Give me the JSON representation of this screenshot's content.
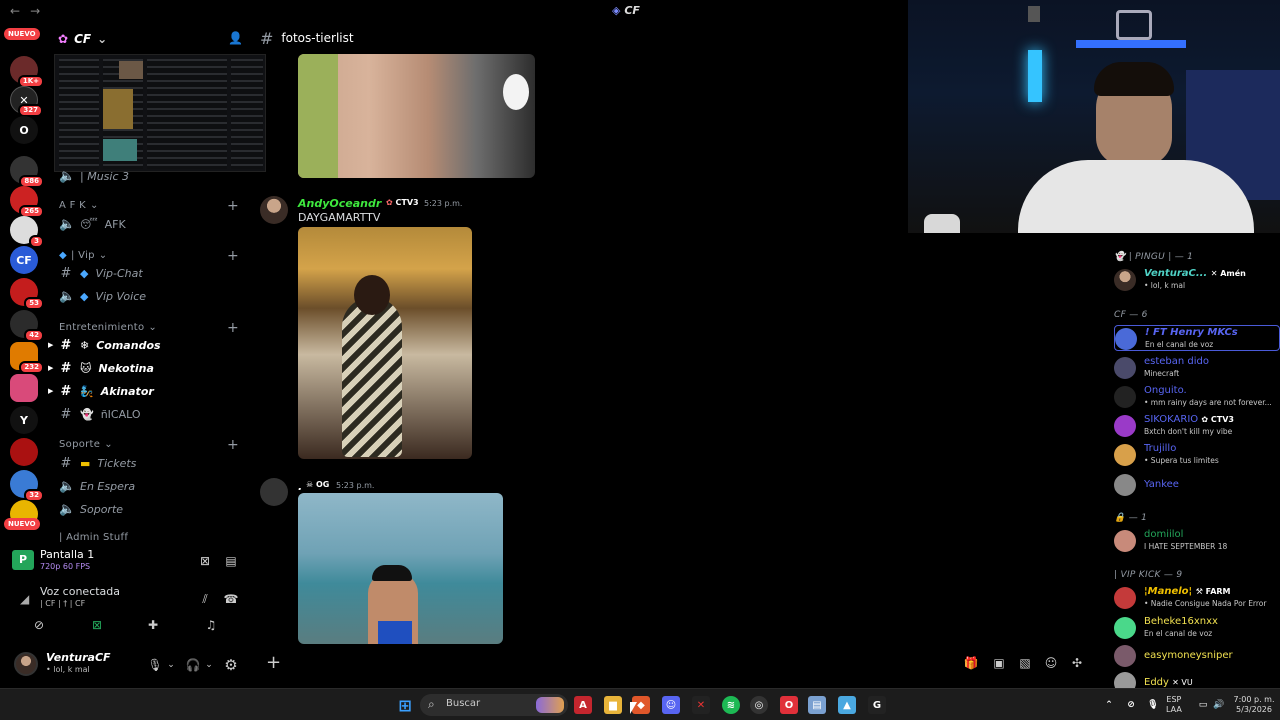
{
  "window": {
    "title": "CF",
    "back": "←",
    "forward": "→"
  },
  "rail": {
    "nuevo_top": "NUEVO",
    "nuevo_bottom": "NUEVO",
    "badges": [
      "1K+",
      "327",
      "886",
      "265",
      "3",
      "53",
      "42",
      "232",
      "32"
    ],
    "letter_server": "O"
  },
  "sidebar": {
    "server_name": "CF",
    "music_channel": "| Music 3",
    "categories": {
      "afk": "A F K",
      "vip": "| Vip",
      "entretenimiento": "Entretenimiento",
      "soporte": "Soporte",
      "admin": "| Admin Stuff"
    },
    "channels": {
      "afk": "AFK",
      "vip_chat": "Vip-Chat",
      "vip_voice": "Vip Voice",
      "comandos": "Comandos",
      "nekotina": "Nekotina",
      "akinator": "Akinator",
      "nicalo": "ñICALO",
      "tickets": "Tickets",
      "en_espera": "En Espera",
      "soporte": "Soporte"
    }
  },
  "panel": {
    "share_title": "Pantalla 1",
    "share_quality": "720p 60 FPS",
    "voice_status": "Voz conectada",
    "voice_channel": "| CF | † | CF",
    "user_name": "VenturaCF",
    "user_status": "• lol, k mal"
  },
  "chat": {
    "channel_name": "fotos-tierlist",
    "messages": [
      {
        "author": "AndyOceandr",
        "tag": "CTV3",
        "time": "5:23 p.m.",
        "text": "DAYGAMARTTV"
      },
      {
        "author": ".",
        "tag": "OG",
        "time": "5:23 p.m.",
        "text": ""
      }
    ]
  },
  "members": {
    "groups": {
      "pingu": "| PINGU | — 1",
      "cf": "CF — 6",
      "lock": "— 1",
      "vipkick": "| VIP KICK — 9"
    },
    "list": [
      {
        "name": "VenturaC...",
        "tag": "Amén",
        "status": "• lol, k mal",
        "color": "#4fd1c5"
      },
      {
        "name": "! FT Henry MKCs",
        "tag": "",
        "status": "En el canal de voz",
        "color": "#5865f2"
      },
      {
        "name": "esteban dido",
        "tag": "",
        "status": "Minecraft",
        "color": "#5865f2"
      },
      {
        "name": "Onguito.",
        "tag": "",
        "status": "• mm rainy days are not forever...",
        "color": "#5865f2"
      },
      {
        "name": "SIKOKARIO",
        "tag": "CTV3",
        "status": "Bxtch don't kill my vibe",
        "color": "#5865f2"
      },
      {
        "name": "Trujillo",
        "tag": "",
        "status": "• Supera tus limites",
        "color": "#5865f2"
      },
      {
        "name": "Yankee",
        "tag": "",
        "status": "",
        "color": "#5865f2"
      },
      {
        "name": "domiilol",
        "tag": "",
        "status": "I HATE SEPTEMBER 18",
        "color": "#23a55a"
      },
      {
        "name": "¦Manelo¦",
        "tag": "FARM",
        "status": "• Nadie Consigue Nada Por Error",
        "color": "#f0c000"
      },
      {
        "name": "Beheke16xnxx",
        "tag": "",
        "status": "En el canal de voz",
        "color": "#f0e050"
      },
      {
        "name": "easymoneysniper",
        "tag": "",
        "status": "",
        "color": "#f0e050"
      },
      {
        "name": "Eddy",
        "tag": "VU",
        "status": "",
        "color": "#f0e050"
      }
    ]
  },
  "taskbar": {
    "search_placeholder": "Buscar",
    "lang1": "ESP",
    "lang2": "LAA",
    "time": "7:00 p. m.",
    "date": "5/3/2026"
  }
}
